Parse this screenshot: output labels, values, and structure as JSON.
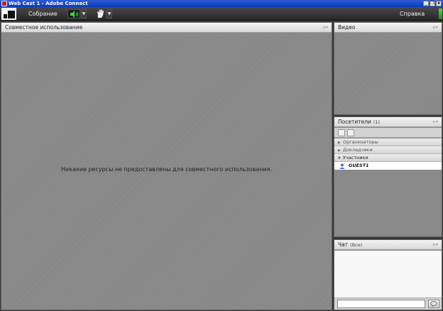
{
  "window": {
    "title": "Web Cast 1 - Adobe Connect",
    "controls": {
      "minimize": "_",
      "restore": "❐",
      "close": "x"
    }
  },
  "menubar": {
    "meeting_label": "Собрание",
    "help_label": "Справка",
    "speaker_icon": "speaker-icon",
    "hand_icon": "raise-hand-icon",
    "status_color": "#2fbf2f"
  },
  "share_pod": {
    "title": "Совместное использование",
    "message": "Никакие ресурсы не предоставлены для совместного использования."
  },
  "video_pod": {
    "title": "Видео"
  },
  "attendees_pod": {
    "title": "Посетители",
    "count": "(1)",
    "roles": [
      {
        "label": "Организаторы",
        "expanded": false
      },
      {
        "label": "Докладчики",
        "expanded": false
      },
      {
        "label": "Участники",
        "expanded": true
      }
    ],
    "participants": [
      {
        "name": "GUEST1"
      }
    ]
  },
  "chat_pod": {
    "title": "Чат",
    "scope": "(Все)",
    "input_value": ""
  },
  "colors": {
    "title_bar": "#0a3ab8",
    "menubar": "#262626",
    "pod_body": "#878787",
    "pod_header": "#e6e6e6"
  }
}
